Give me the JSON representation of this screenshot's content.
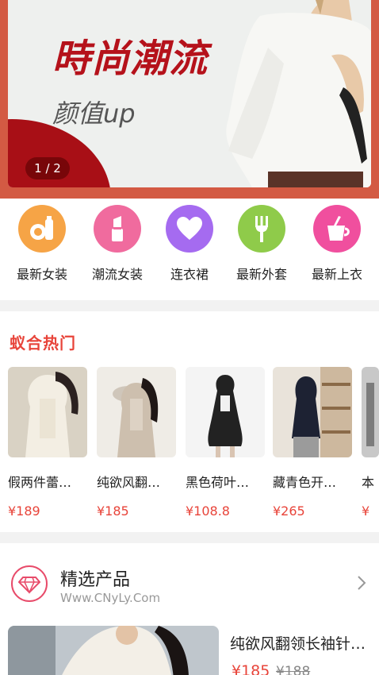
{
  "banner": {
    "title": "時尚潮流",
    "subtitle": "颜值up",
    "pager": "1 / 2"
  },
  "categories": [
    {
      "label": "最新女装",
      "icon": "fruit-bottle-icon",
      "color": "#f6a446"
    },
    {
      "label": "潮流女装",
      "icon": "lipstick-icon",
      "color": "#f06b9e"
    },
    {
      "label": "连衣裙",
      "icon": "heart-icon",
      "color": "#a56bf0"
    },
    {
      "label": "最新外套",
      "icon": "fork-icon",
      "color": "#8fcb4a"
    },
    {
      "label": "最新上衣",
      "icon": "drink-cup-icon",
      "color": "#f04f9e"
    }
  ],
  "hot": {
    "heading": "蚁合热门",
    "items": [
      {
        "name": "假两件蕾…",
        "price": "¥189"
      },
      {
        "name": "纯欲风翻…",
        "price": "¥185"
      },
      {
        "name": "黑色荷叶…",
        "price": "¥108.8"
      },
      {
        "name": "藏青色开…",
        "price": "¥265"
      },
      {
        "name": "本",
        "price": "¥"
      }
    ]
  },
  "selected": {
    "title": "精选产品",
    "url": "Www.CNyLy.Com",
    "product": {
      "name": "纯欲风翻领长袖针…",
      "price": "¥185",
      "old_price": "¥188"
    }
  },
  "colors": {
    "accent": "#e8443a",
    "banner_bg": "#d35a43",
    "banner_red": "#b5121b"
  }
}
